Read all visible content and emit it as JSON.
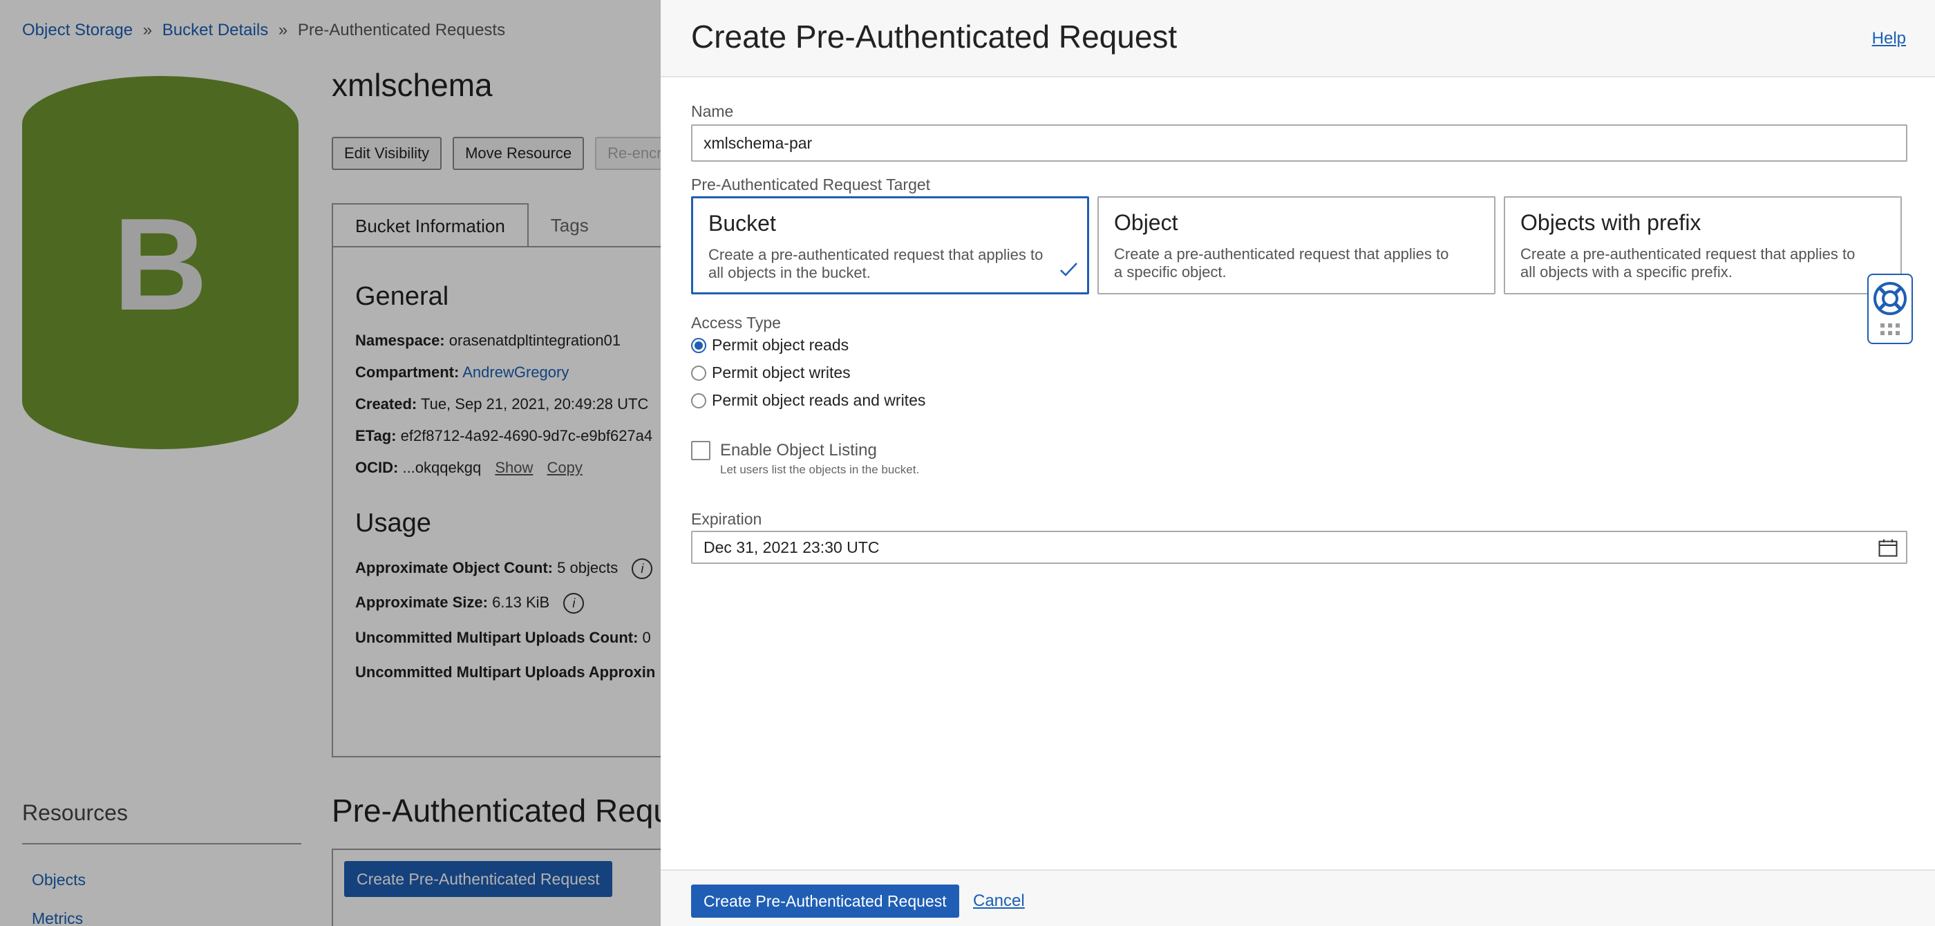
{
  "breadcrumb": {
    "items": [
      "Object Storage",
      "Bucket Details"
    ],
    "separator": "»",
    "current": "Pre-Authenticated Requests"
  },
  "bucket": {
    "icon_letter": "B",
    "icon_color": "#6f962e",
    "title": "xmlschema",
    "actions": [
      "Edit Visibility",
      "Move Resource",
      "Re-encr"
    ],
    "tabs": [
      "Bucket Information",
      "Tags"
    ],
    "general_heading": "General",
    "namespace_label": "Namespace:",
    "namespace_value": "orasenatdpltintegration01",
    "compartment_label": "Compartment:",
    "compartment_value": "AndrewGregory",
    "created_label": "Created:",
    "created_value": "Tue, Sep 21, 2021, 20:49:28 UTC",
    "etag_label": "ETag:",
    "etag_value": "ef2f8712-4a92-4690-9d7c-e9bf627a4",
    "ocid_label": "OCID:",
    "ocid_value": "...okqqekgq",
    "ocid_show": "Show",
    "ocid_copy": "Copy",
    "usage_heading": "Usage",
    "obj_count_label": "Approximate Object Count:",
    "obj_count_value": "5 objects",
    "size_label": "Approximate Size:",
    "size_value": "6.13 KiB",
    "multipart_count_label": "Uncommitted Multipart Uploads Count:",
    "multipart_count_value": "0",
    "multipart_size_label": "Uncommitted Multipart Uploads Approxin"
  },
  "resources": {
    "heading": "Resources",
    "links": [
      "Objects",
      "Metrics"
    ]
  },
  "par_section": {
    "heading": "Pre-Authenticated Requ",
    "create_button": "Create Pre-Authenticated Request"
  },
  "drawer": {
    "title": "Create Pre-Authenticated Request",
    "help_link": "Help",
    "name_label": "Name",
    "name_value": "xmlschema-par",
    "target_label": "Pre-Authenticated Request Target",
    "targets": [
      {
        "title": "Bucket",
        "desc": "Create a pre-authenticated request that applies to all objects in the bucket.",
        "selected": true
      },
      {
        "title": "Object",
        "desc": "Create a pre-authenticated request that applies to a specific object.",
        "selected": false
      },
      {
        "title": "Objects with prefix",
        "desc": "Create a pre-authenticated request that applies to all objects with a specific prefix.",
        "selected": false
      }
    ],
    "access_label": "Access Type",
    "access_options": [
      {
        "label": "Permit object reads",
        "checked": true
      },
      {
        "label": "Permit object writes",
        "checked": false
      },
      {
        "label": "Permit object reads and writes",
        "checked": false
      }
    ],
    "listing_label": "Enable Object Listing",
    "listing_help": "Let users list the objects in the bucket.",
    "listing_checked": false,
    "expiration_label": "Expiration",
    "expiration_value": "Dec 31, 2021 23:30 UTC",
    "submit_button": "Create Pre-Authenticated Request",
    "cancel_link": "Cancel"
  },
  "colors": {
    "accent": "#1f5eb4",
    "link": "#1a5fb4",
    "bucket_green": "#6f962e"
  },
  "icons": {
    "help_widget": "lifebuoy-icon",
    "calendar": "calendar-icon",
    "check": "checkmark-icon",
    "info": "info-icon"
  }
}
